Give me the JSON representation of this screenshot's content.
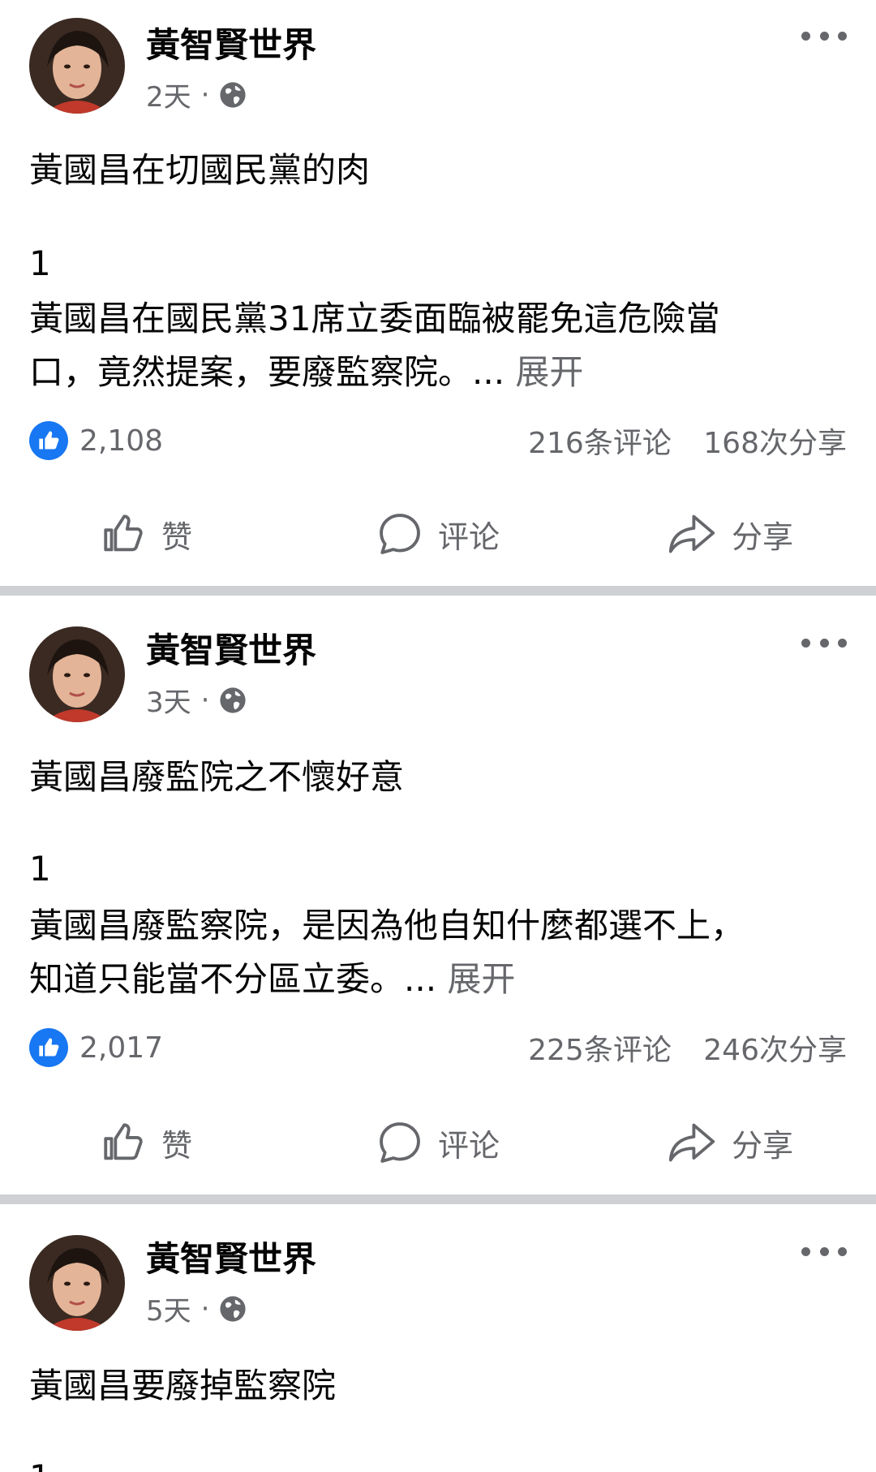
{
  "posts": [
    {
      "author": "黃智賢世界",
      "time": "2天",
      "title": "黃國昌在切國民黨的肉",
      "number": "1",
      "body_line1": "黃國昌在國民黨31席立委面臨被罷免這危險當",
      "body_line2": "口，竟然提案，要廢監察院。...",
      "see_more": "展开",
      "likes": "2,108",
      "comments": "216条评论",
      "shares": "168次分享",
      "like_label": "赞",
      "comment_label": "评论",
      "share_label": "分享"
    },
    {
      "author": "黃智賢世界",
      "time": "3天",
      "title": "黃國昌廢監院之不懷好意",
      "number": "1",
      "body_line1": "黃國昌廢監察院，是因為他自知什麼都選不上，",
      "body_line2": "知道只能當不分區立委。...",
      "see_more": "展开",
      "likes": "2,017",
      "comments": "225条评论",
      "shares": "246次分享",
      "like_label": "赞",
      "comment_label": "评论",
      "share_label": "分享"
    },
    {
      "author": "黃智賢世界",
      "time": "5天",
      "title": "黃國昌要廢掉監察院",
      "number": "1"
    }
  ],
  "icons": {
    "globe": "globe-icon",
    "more": "more-horizontal-icon",
    "like_badge": "thumbs-up-badge-icon",
    "like": "thumbs-up-outline-icon",
    "comment": "speech-bubble-icon",
    "share": "share-arrow-icon"
  },
  "colors": {
    "brand_blue": "#1877f2",
    "secondary_text": "#65676b",
    "separator": "#ced0d4"
  }
}
